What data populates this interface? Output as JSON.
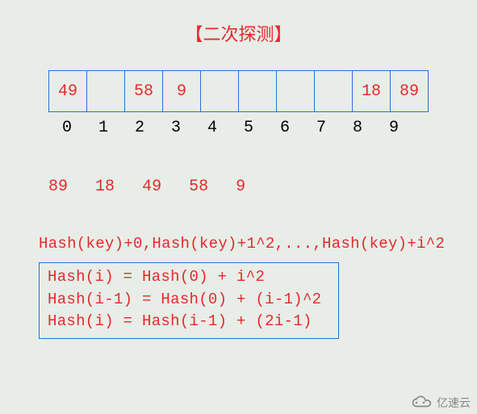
{
  "title": "【二次探测】",
  "table": {
    "cells": [
      "49",
      "",
      "58",
      "9",
      "",
      "",
      "",
      "",
      "18",
      "89"
    ],
    "indices": [
      "0",
      "1",
      "2",
      "3",
      "4",
      "5",
      "6",
      "7",
      "8",
      "9"
    ]
  },
  "sequence": [
    "89",
    "18",
    "49",
    "58",
    "9"
  ],
  "formula_line": "Hash(key)+0,Hash(key)+1^2,...,Hash(key)+i^2",
  "formula_box": {
    "line1": "Hash(i) = Hash(0) + i^2",
    "line2": "Hash(i-1) = Hash(0) + (i-1)^2",
    "line3": "Hash(i) = Hash(i-1) + (2i-1)"
  },
  "watermark": "亿速云"
}
